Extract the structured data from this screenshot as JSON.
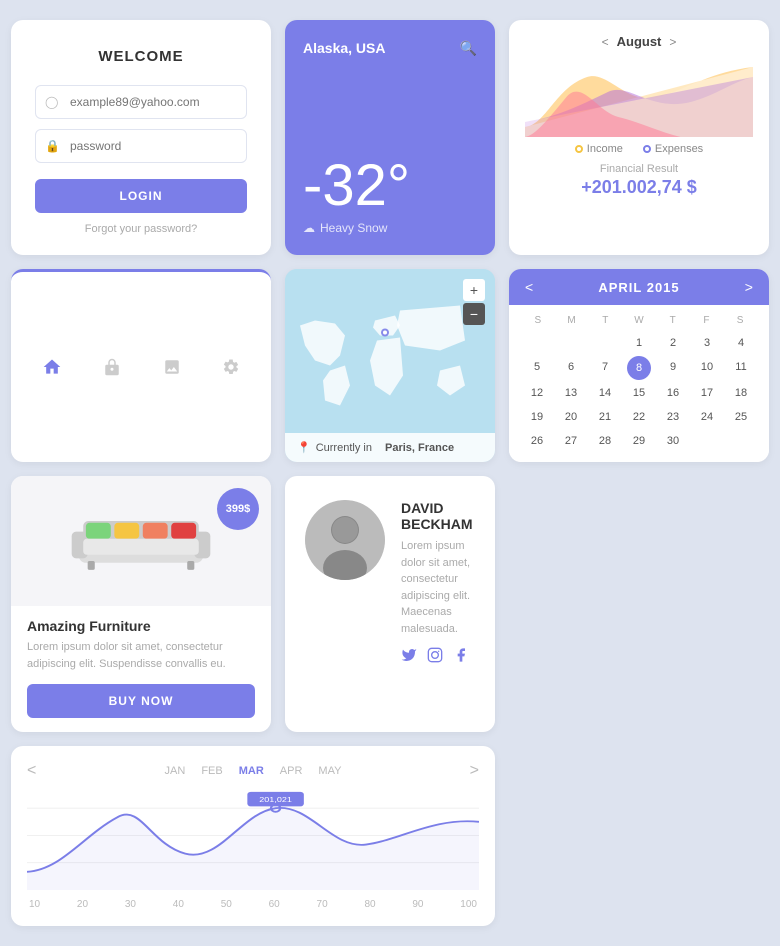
{
  "login": {
    "title": "WELCOME",
    "email_placeholder": "example89@yahoo.com",
    "password_placeholder": "password",
    "login_label": "LOGIN",
    "forgot_label": "Forgot your password?"
  },
  "weather": {
    "location": "Alaska, USA",
    "temperature": "-32°",
    "description": "Heavy Snow"
  },
  "finance": {
    "month_prev": "<",
    "month_next": ">",
    "month_name": "August",
    "legend_income": "Income",
    "legend_expenses": "Expenses",
    "result_label": "Financial Result",
    "result_value": "+201.002,74 $"
  },
  "nav": {
    "icons": [
      "home",
      "lock",
      "image",
      "settings"
    ]
  },
  "map": {
    "location_label": "Currently in",
    "location_city": "Paris, France",
    "zoom_in": "+",
    "zoom_out": "-"
  },
  "calendar": {
    "prev": "<",
    "next": ">",
    "month_year": "APRIL 2015",
    "day_headers": [
      "S",
      "M",
      "T",
      "W",
      "T",
      "F",
      "S"
    ],
    "today": "8",
    "weeks": [
      [
        "",
        "",
        "",
        "1",
        "2",
        "3",
        "4"
      ],
      [
        "5",
        "6",
        "7",
        "8",
        "9",
        "10",
        "11"
      ],
      [
        "12",
        "13",
        "14",
        "15",
        "16",
        "17",
        "18"
      ],
      [
        "19",
        "20",
        "21",
        "22",
        "23",
        "24",
        "25"
      ],
      [
        "26",
        "27",
        "28",
        "29",
        "30",
        "",
        ""
      ]
    ]
  },
  "furniture": {
    "price": "399$",
    "name": "Amazing Furniture",
    "description": "Lorem ipsum dolor sit amet, consectetur adipiscing elit. Suspendisse convallis eu.",
    "buy_label": "BUY NOW"
  },
  "profile": {
    "name": "DAVID BECKHAM",
    "bio": "Lorem ipsum dolor sit amet, consectetur adipiscing elit. Maecenas malesuada.",
    "social": [
      "twitter",
      "instagram",
      "facebook"
    ]
  },
  "linechart": {
    "prev": "<",
    "next": ">",
    "months": [
      "JAN",
      "FEB",
      "MAR",
      "APR",
      "MAY"
    ],
    "active_month": "MAR",
    "tooltip": "201,021",
    "x_labels": [
      "10",
      "20",
      "30",
      "40",
      "50",
      "60",
      "70",
      "80",
      "90",
      "100"
    ]
  }
}
